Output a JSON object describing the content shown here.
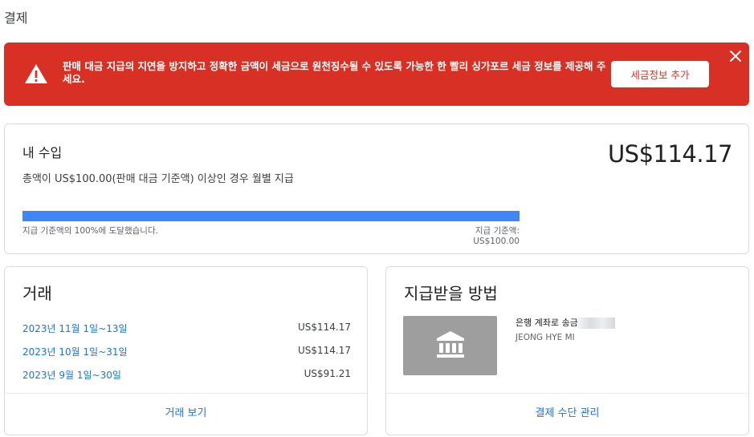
{
  "page": {
    "title": "결제"
  },
  "alert": {
    "message": "판매 대금 지급의 지연을 방지하고 정확한 금액이 세금으로 원천징수될 수 있도록 가능한 한 빨리 싱가포르 세금 정보를 제공해 주세요.",
    "action_label": "세금정보 추가",
    "background_color": "#d93025",
    "icons": {
      "warning": "warning-icon",
      "close": "close-icon"
    }
  },
  "earnings": {
    "title": "내 수입",
    "amount": "US$114.17",
    "description": "총액이 US$100.00(판매 대금 기준액) 이상인 경우 월별 지급",
    "progress_fraction": 1.0,
    "progress_label_left": "지급 기준액의 100%에 도달했습니다.",
    "progress_label_right": "지급 기준액: US$100.00",
    "progress_color": "#4285f4"
  },
  "transactions": {
    "title": "거래",
    "rows": [
      {
        "period": "2023년 11월 1일~13일",
        "amount": "US$114.17"
      },
      {
        "period": "2023년 10월 1일~31일",
        "amount": "US$114.17"
      },
      {
        "period": "2023년 9월 1일~30일",
        "amount": "US$91.21"
      }
    ],
    "footer_label": "거래 보기"
  },
  "payout": {
    "title": "지급받을 방법",
    "method_label": "은행 계좌로 송금",
    "account_holder": "JEONG HYE MI",
    "icon": "bank-icon",
    "footer_label": "결제 수단 관리"
  },
  "link_color": "#1a73e8"
}
